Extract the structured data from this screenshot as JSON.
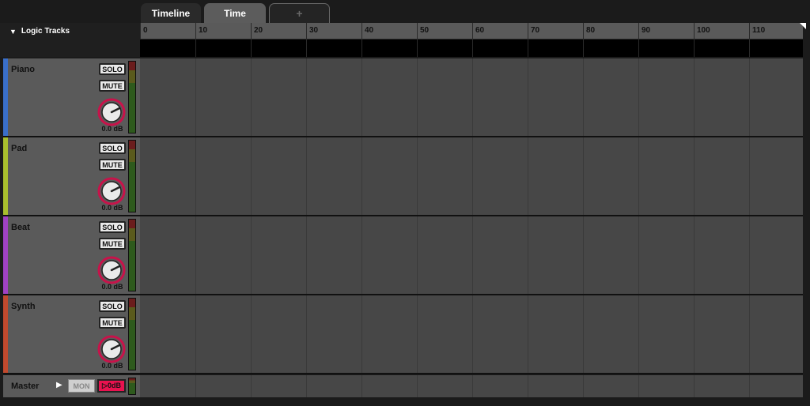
{
  "tabs": [
    {
      "label": "Timeline"
    },
    {
      "label": "Time"
    },
    {
      "label": "+"
    }
  ],
  "header": {
    "title": "Logic Tracks"
  },
  "ruler": {
    "ticks": [
      "0",
      "10",
      "20",
      "30",
      "40",
      "50",
      "60",
      "70",
      "80",
      "90",
      "100",
      "110"
    ]
  },
  "tracks": [
    {
      "name": "Piano",
      "solo": "SOLO",
      "mute": "MUTE",
      "gain": "0.0 dB",
      "color": "#3a6fc9"
    },
    {
      "name": "Pad",
      "solo": "SOLO",
      "mute": "MUTE",
      "gain": "0.0 dB",
      "color": "#a9bf2e"
    },
    {
      "name": "Beat",
      "solo": "SOLO",
      "mute": "MUTE",
      "gain": "0.0 dB",
      "color": "#a042c4"
    },
    {
      "name": "Synth",
      "solo": "SOLO",
      "mute": "MUTE",
      "gain": "0.0 dB",
      "color": "#c14a2e"
    }
  ],
  "master": {
    "name": "Master",
    "mon": "MON",
    "limiter": "▷0dB"
  },
  "colors": {
    "accent": "#e8124f"
  }
}
